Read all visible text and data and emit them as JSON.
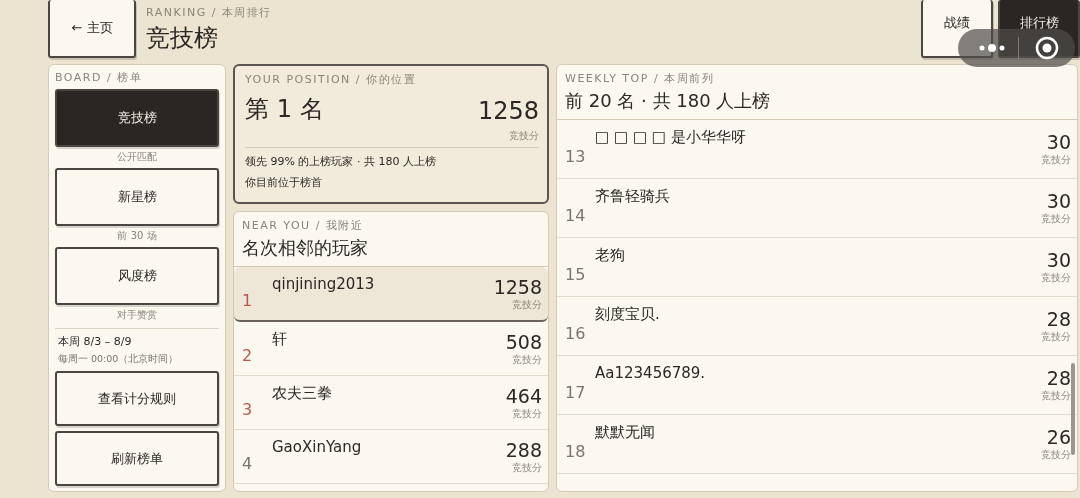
{
  "header": {
    "back_button": "← 主页",
    "eyebrow": "RANKING / 本周排行",
    "title": "竞技榜",
    "tabs": [
      {
        "label": "战绩",
        "selected": false
      },
      {
        "label": "排行榜",
        "selected": true
      }
    ]
  },
  "board": {
    "eyebrow": "BOARD / 榜单",
    "items": [
      {
        "label": "竞技榜",
        "caption": "公开匹配",
        "selected": true
      },
      {
        "label": "新星榜",
        "caption": "前 30 场",
        "selected": false
      },
      {
        "label": "风度榜",
        "caption": "对手赞赏",
        "selected": false
      }
    ],
    "week": "本周 8/3 – 8/9",
    "reset": "每周一 00:00（北京时间）",
    "buttons": [
      "查看计分规则",
      "刷新榜单"
    ]
  },
  "position": {
    "eyebrow": "YOUR POSITION / 你的位置",
    "rank": "第 1 名",
    "score": "1258",
    "score_label": "竞技分",
    "lead": "领先 99% 的上榜玩家 · 共 180 人上榜",
    "note": "你目前位于榜首"
  },
  "near": {
    "eyebrow": "NEAR YOU / 我附近",
    "title": "名次相邻的玩家",
    "rows": [
      {
        "rank": "1",
        "name": "qinjining2013",
        "score": "1258",
        "score_label": "竞技分",
        "selected": true,
        "color": "#b5584e"
      },
      {
        "rank": "2",
        "name": "轩",
        "score": "508",
        "score_label": "竞技分",
        "selected": false,
        "color": "#b5584e"
      },
      {
        "rank": "3",
        "name": "农夫三拳",
        "score": "464",
        "score_label": "竞技分",
        "selected": false,
        "color": "#b5584e"
      },
      {
        "rank": "4",
        "name": "GaoXinYang",
        "score": "288",
        "score_label": "竞技分",
        "selected": false,
        "color": "#7a756d"
      }
    ]
  },
  "weekly": {
    "eyebrow": "WEEKLY TOP / 本周前列",
    "title": "前 20 名 · 共 180 人上榜",
    "rows": [
      {
        "rank": "13",
        "name": "□ □ □ □ 是小华华呀",
        "score": "30",
        "score_label": "竞技分"
      },
      {
        "rank": "14",
        "name": "齐鲁轻骑兵",
        "score": "30",
        "score_label": "竞技分"
      },
      {
        "rank": "15",
        "name": "老狗",
        "score": "30",
        "score_label": "竞技分"
      },
      {
        "rank": "16",
        "name": "刻度宝贝.",
        "score": "28",
        "score_label": "竞技分"
      },
      {
        "rank": "17",
        "name": "Aa123456789.",
        "score": "28",
        "score_label": "竞技分"
      },
      {
        "rank": "18",
        "name": "默默无闻",
        "score": "26",
        "score_label": "竞技分"
      }
    ]
  }
}
